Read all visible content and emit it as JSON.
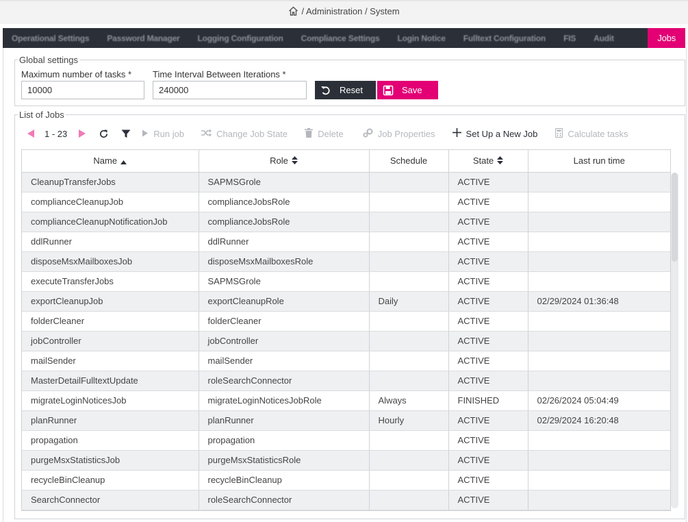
{
  "breadcrumb": {
    "path": "/ Administration / System"
  },
  "tabs": [
    {
      "label": "Operational Settings"
    },
    {
      "label": "Password Manager"
    },
    {
      "label": "Logging Configuration"
    },
    {
      "label": "Compliance Settings"
    },
    {
      "label": "Login Notice"
    },
    {
      "label": "Fulltext Configuration"
    },
    {
      "label": "FIS"
    },
    {
      "label": "Audit"
    },
    {
      "label": "Jobs"
    }
  ],
  "global_settings": {
    "legend": "Global settings",
    "max_tasks_label": "Maximum number of tasks  *",
    "max_tasks_value": "10000",
    "interval_label": "Time Interval Between Iterations  *",
    "interval_value": "240000",
    "reset_label": "Reset",
    "save_label": "Save"
  },
  "jobs": {
    "legend": "List of Jobs",
    "pager": "1 - 23",
    "toolbar": {
      "run": "Run job",
      "change_state": "Change Job State",
      "delete": "Delete",
      "properties": "Job Properties",
      "new_job": "Set Up a New Job",
      "calculate": "Calculate tasks"
    },
    "columns": [
      "Name",
      "Role",
      "Schedule",
      "State",
      "Last run time"
    ],
    "rows": [
      {
        "name": "CleanupTransferJobs",
        "role": "SAPMSGrole",
        "schedule": "",
        "state": "ACTIVE",
        "last": ""
      },
      {
        "name": "complianceCleanupJob",
        "role": "complianceJobsRole",
        "schedule": "",
        "state": "ACTIVE",
        "last": ""
      },
      {
        "name": "complianceCleanupNotificationJob",
        "role": "complianceJobsRole",
        "schedule": "",
        "state": "ACTIVE",
        "last": ""
      },
      {
        "name": "ddlRunner",
        "role": "ddlRunner",
        "schedule": "",
        "state": "ACTIVE",
        "last": ""
      },
      {
        "name": "disposeMsxMailboxesJob",
        "role": "disposeMsxMailboxesRole",
        "schedule": "",
        "state": "ACTIVE",
        "last": ""
      },
      {
        "name": "executeTransferJobs",
        "role": "SAPMSGrole",
        "schedule": "",
        "state": "ACTIVE",
        "last": ""
      },
      {
        "name": "exportCleanupJob",
        "role": "exportCleanupRole",
        "schedule": "Daily",
        "state": "ACTIVE",
        "last": "02/29/2024 01:36:48"
      },
      {
        "name": "folderCleaner",
        "role": "folderCleaner",
        "schedule": "",
        "state": "ACTIVE",
        "last": ""
      },
      {
        "name": "jobController",
        "role": "jobController",
        "schedule": "",
        "state": "ACTIVE",
        "last": ""
      },
      {
        "name": "mailSender",
        "role": "mailSender",
        "schedule": "",
        "state": "ACTIVE",
        "last": ""
      },
      {
        "name": "MasterDetailFulltextUpdate",
        "role": "roleSearchConnector",
        "schedule": "",
        "state": "ACTIVE",
        "last": ""
      },
      {
        "name": "migrateLoginNoticesJob",
        "role": "migrateLoginNoticesJobRole",
        "schedule": "Always",
        "state": "FINISHED",
        "last": "02/26/2024 05:04:49"
      },
      {
        "name": "planRunner",
        "role": "planRunner",
        "schedule": "Hourly",
        "state": "ACTIVE",
        "last": "02/29/2024 16:20:48"
      },
      {
        "name": "propagation",
        "role": "propagation",
        "schedule": "",
        "state": "ACTIVE",
        "last": ""
      },
      {
        "name": "purgeMsxStatisticsJob",
        "role": "purgeMsxStatisticsRole",
        "schedule": "",
        "state": "ACTIVE",
        "last": ""
      },
      {
        "name": "recycleBinCleanup",
        "role": "recycleBinCleanup",
        "schedule": "",
        "state": "ACTIVE",
        "last": ""
      },
      {
        "name": "SearchConnector",
        "role": "roleSearchConnector",
        "schedule": "",
        "state": "ACTIVE",
        "last": ""
      }
    ]
  },
  "colors": {
    "accent": "#e20074",
    "dark": "#2b3038"
  }
}
